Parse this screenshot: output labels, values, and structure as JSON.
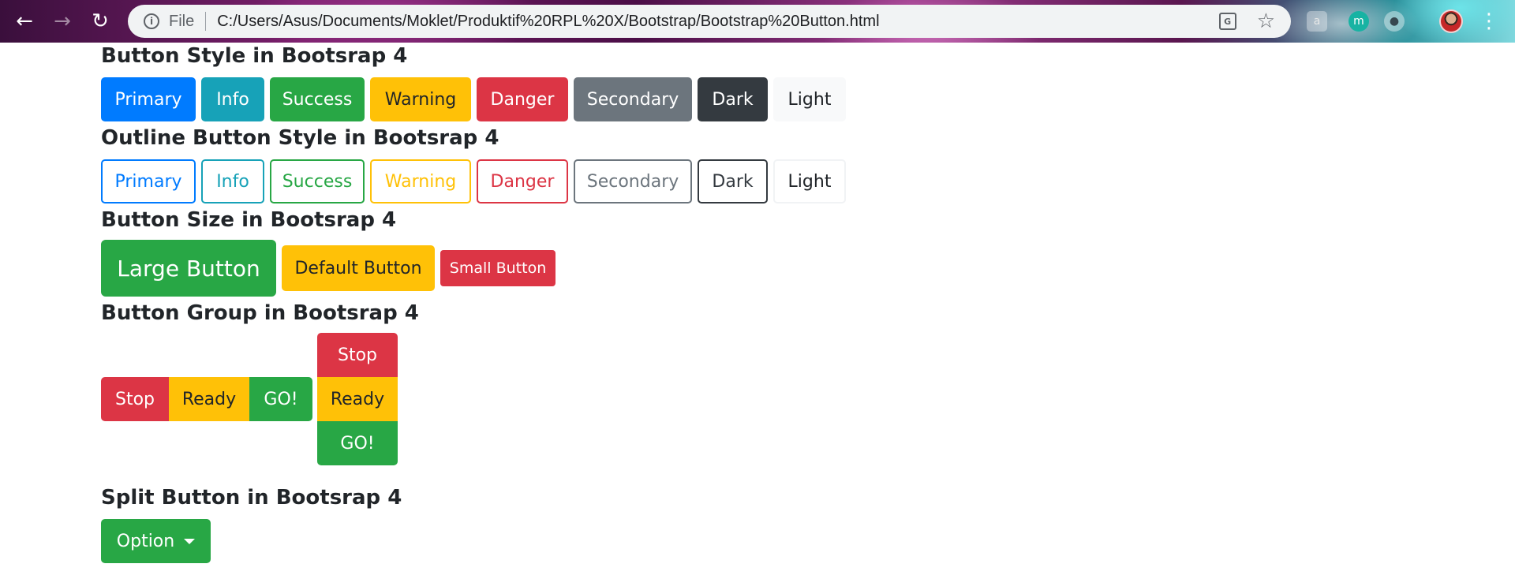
{
  "browser": {
    "file_label": "File",
    "url": "C:/Users/Asus/Documents/Moklet/Produktif%20RPL%20X/Bootstrap/Bootstrap%20Button.html",
    "icons": {
      "back": "arrow-left",
      "forward": "arrow-right",
      "reload": "reload",
      "info": "info",
      "translate": "translate",
      "bookmark": "star",
      "extension_a": "a",
      "extension_m": "m",
      "extension_bulb": "bulb",
      "menu": "more-vert"
    }
  },
  "sections": {
    "styles": {
      "title": "Button Style in Bootsrap 4",
      "buttons": [
        "Primary",
        "Info",
        "Success",
        "Warning",
        "Danger",
        "Secondary",
        "Dark",
        "Light"
      ]
    },
    "outline": {
      "title": "Outline Button Style in Bootsrap 4",
      "buttons": [
        "Primary",
        "Info",
        "Success",
        "Warning",
        "Danger",
        "Secondary",
        "Dark",
        "Light"
      ]
    },
    "size": {
      "title": "Button Size in Bootsrap 4",
      "large": "Large Button",
      "default": "Default Button",
      "small": "Small Button"
    },
    "group": {
      "title": "Button Group in Bootsrap 4",
      "horizontal": [
        "Stop",
        "Ready",
        "GO!"
      ],
      "vertical": [
        "Stop",
        "Ready",
        "GO!"
      ]
    },
    "split": {
      "title": "Split Button in Bootsrap 4",
      "button": "Option"
    }
  },
  "colors": {
    "primary": "#007bff",
    "info": "#17a2b8",
    "success": "#28a745",
    "warning": "#ffc107",
    "danger": "#dc3545",
    "secondary": "#6c757d",
    "dark": "#343a40",
    "light": "#f8f9fa"
  }
}
